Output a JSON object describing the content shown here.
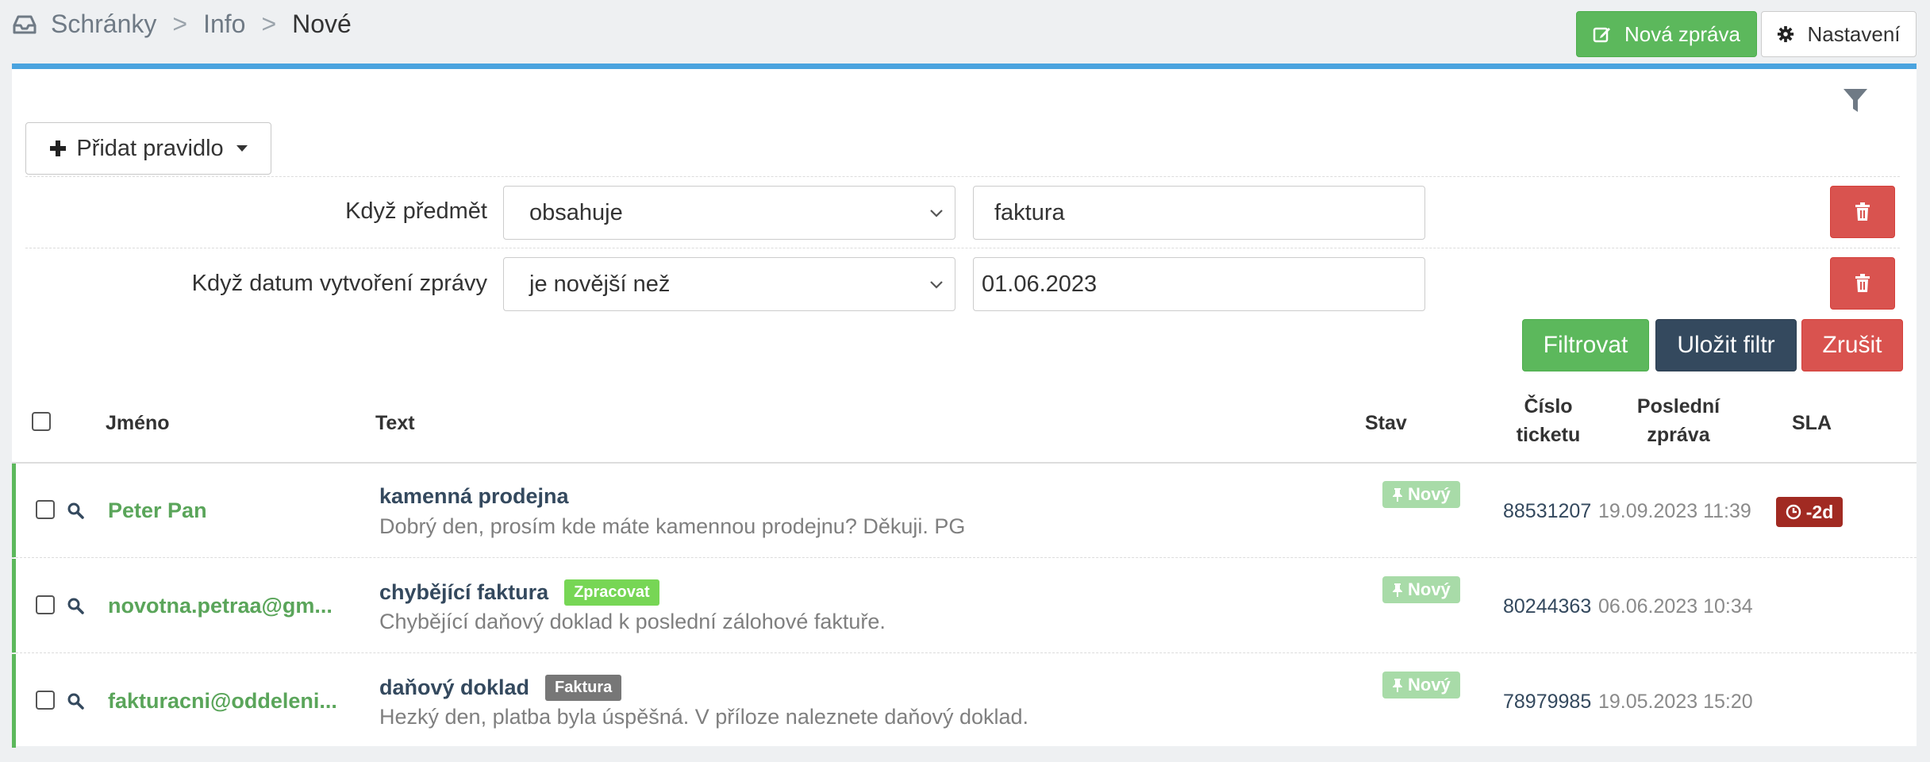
{
  "breadcrumb": {
    "items": [
      "Schránky",
      "Info"
    ],
    "separator": ">",
    "current": "Nové"
  },
  "toolbar": {
    "new_message_label": "Nová zpráva",
    "settings_label": "Nastavení"
  },
  "filter": {
    "add_rule_label": "Přidat pravidlo",
    "rules": [
      {
        "label": "Když předmět",
        "operator": "obsahuje",
        "value": "faktura"
      },
      {
        "label": "Když datum vytvoření zprávy",
        "operator": "je novější než",
        "value": "01.06.2023"
      }
    ],
    "filter_label": "Filtrovat",
    "save_label": "Uložit filtr",
    "cancel_label": "Zrušit"
  },
  "table": {
    "columns": {
      "name": "Jméno",
      "text": "Text",
      "status": "Stav",
      "ticket_line1": "Číslo",
      "ticket_line2": "ticketu",
      "last_line1": "Poslední",
      "last_line2": "zpráva",
      "sla": "SLA"
    },
    "rows": [
      {
        "name": "Peter Pan",
        "subject": "kamenná prodejna",
        "tag": "",
        "snippet": "Dobrý den,  prosím kde máte kamennou prodejnu? Děkuji. PG",
        "status": "Nový",
        "ticket": "88531207",
        "last_message": "19.09.2023 11:39",
        "sla": "-2d"
      },
      {
        "name": "novotna.petraa@gm...",
        "subject": "chybějící faktura",
        "tag": "Zpracovat",
        "snippet": "Chybějící daňový doklad k poslední zálohové faktuře.",
        "status": "Nový",
        "ticket": "80244363",
        "last_message": "06.06.2023 10:34",
        "sla": ""
      },
      {
        "name": "fakturacni@oddeleni...",
        "subject": "daňový doklad",
        "tag": "Faktura",
        "snippet": "Hezký den, platba byla úspěšná. V příloze naleznete daňový doklad.",
        "status": "Nový",
        "ticket": "78979985",
        "last_message": "19.05.2023 15:20",
        "sla": ""
      }
    ]
  },
  "colors": {
    "primary": "#5cb85c",
    "danger": "#d9534f",
    "dark": "#34495e",
    "accent_bar": "#4aa3df",
    "sla_overdue": "#a12a22"
  },
  "icons": [
    "inbox-icon",
    "edit-icon",
    "gear-icon",
    "filter-icon",
    "plus-icon",
    "trash-icon",
    "chevron-down-icon",
    "search-icon",
    "pin-icon",
    "clock-icon"
  ]
}
